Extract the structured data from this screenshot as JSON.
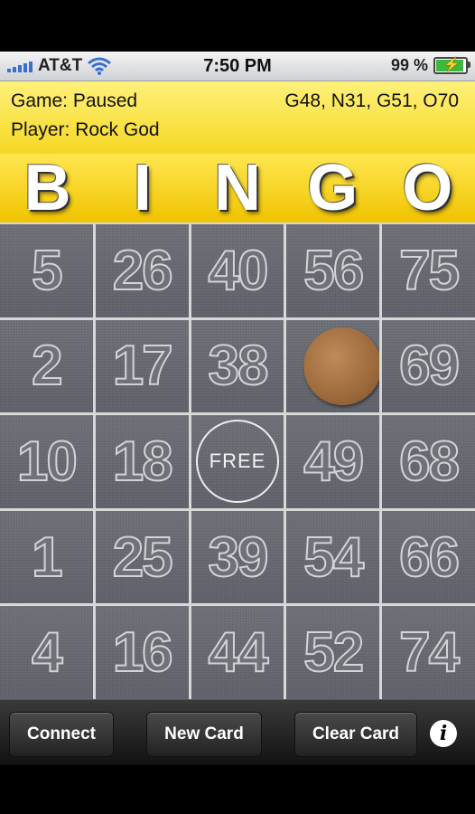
{
  "status_bar": {
    "carrier": "AT&T",
    "time": "7:50 PM",
    "battery_percent": "99 %",
    "battery_level": 0.99
  },
  "header": {
    "game_status": "Game: Paused",
    "player": "Player: Rock God",
    "called_numbers": "G48, N31, G51, O70"
  },
  "bingo_letters": [
    "B",
    "I",
    "N",
    "G",
    "O"
  ],
  "card": {
    "rows": [
      [
        "5",
        "26",
        "40",
        "56",
        "75"
      ],
      [
        "2",
        "17",
        "38",
        "",
        "69"
      ],
      [
        "10",
        "18",
        "FREE",
        "49",
        "68"
      ],
      [
        "1",
        "25",
        "39",
        "54",
        "66"
      ],
      [
        "4",
        "16",
        "44",
        "52",
        "74"
      ]
    ],
    "free_label": "FREE",
    "marked_cell": "row 2, column G"
  },
  "toolbar": {
    "connect_label": "Connect",
    "new_card_label": "New Card",
    "clear_card_label": "Clear Card",
    "info_icon": "info-icon"
  },
  "colors": {
    "header_yellow": "#f5d823",
    "tile_gray": "#666870",
    "marker_brown": "#9c6a3c"
  }
}
